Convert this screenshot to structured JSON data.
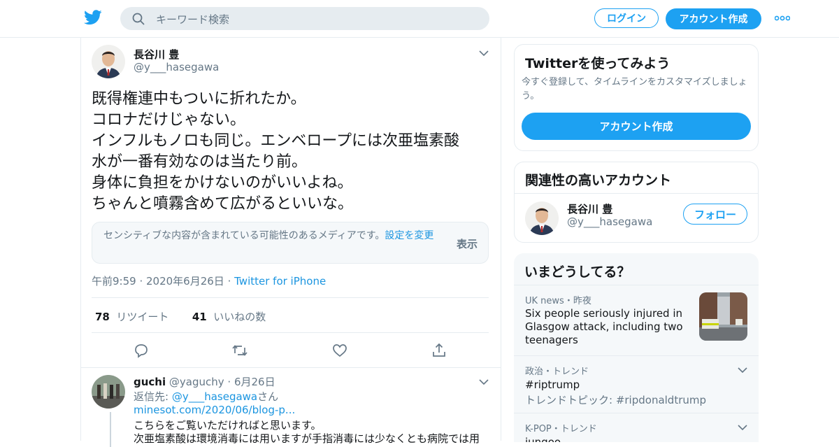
{
  "header": {
    "search_placeholder": "キーワード検索",
    "login_label": "ログイン",
    "signup_label": "アカウント作成"
  },
  "tweet": {
    "author_name": "長谷川 豊",
    "author_handle": "@y___hasegawa",
    "text_lines": [
      "既得権連中もついに折れたか。",
      "コロナだけじゃない。",
      "インフルもノロも同じ。エンベロープには次亜塩素酸",
      "水が一番有効なのは当たり前。",
      "身体に負担をかけないのがいいよね。",
      "ちゃんと噴霧含めて広がるといいな。"
    ],
    "sensitive_notice": "センシティブな内容が含まれている可能性のあるメディアです。",
    "sensitive_settings_link": "設定を変更",
    "sensitive_show": "表示",
    "time": "午前9:59",
    "date": "2020年6月26日",
    "source": "Twitter for iPhone",
    "retweet_count": "78",
    "retweet_label": "リツイート",
    "like_count": "41",
    "like_label": "いいねの数"
  },
  "reply": {
    "author_name": "guchi",
    "author_handle": "@yaguchy",
    "date": "6月26日",
    "reply_to_prefix": "返信先: ",
    "reply_to_handle": "@y___hasegawa",
    "reply_to_suffix": "さん",
    "link": "minesot.com/2020/06/blog-p...",
    "line1": "こちらをご覧いただければと思います。",
    "line2": "次亜塩素酸は環境消毒には用いますが手指消毒には少なくとも病院では用"
  },
  "signup_card": {
    "title": "Twitterを使ってみよう",
    "subtitle": "今すぐ登録して、タイムラインをカスタマイズしましょう。",
    "button": "アカウント作成"
  },
  "related_card": {
    "title": "関連性の高いアカウント",
    "name": "長谷川 豊",
    "handle": "@y___hasegawa",
    "follow_label": "フォロー"
  },
  "trends": {
    "title": "いまどうしてる？",
    "items": [
      {
        "context": "UK news・昨夜",
        "title": "Six people seriously injured in Glasgow attack, including two teenagers",
        "sub": ""
      },
      {
        "context": "政治・トレンド",
        "title": "#riptrump",
        "sub": "トレンドトピック: #ripdonaldtrump"
      },
      {
        "context": "K-POP・トレンド",
        "title": "jungoo",
        "sub": ""
      }
    ]
  },
  "colors": {
    "accent": "#1da1f2",
    "link": "#1b95e0",
    "muted": "#657786",
    "border": "#e6ecf0"
  }
}
